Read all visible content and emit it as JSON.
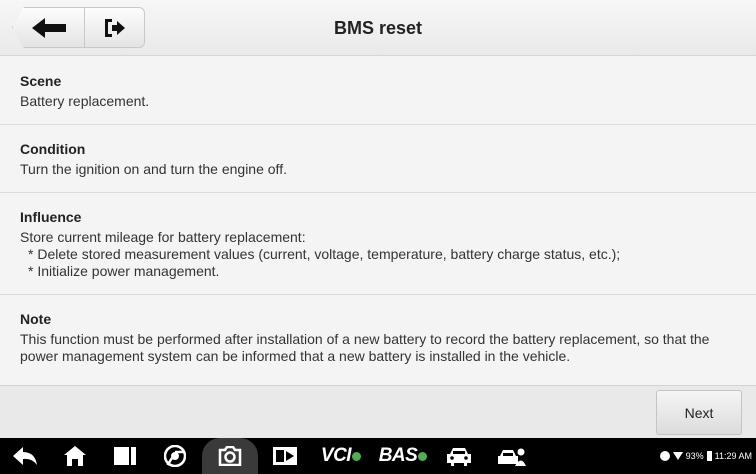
{
  "header": {
    "title": "BMS reset",
    "back_icon": "back-arrow-icon",
    "exit_icon": "exit-icon"
  },
  "sections": [
    {
      "title": "Scene",
      "body": "Battery replacement."
    },
    {
      "title": "Condition",
      "body": "Turn the ignition on and turn the engine off."
    },
    {
      "title": "Influence",
      "body": "Store current mileage for battery replacement:",
      "items": [
        "* Delete stored measurement values (current, voltage, temperature, battery charge status, etc.);",
        "* Initialize power management."
      ]
    },
    {
      "title": "Note",
      "body": "This function must be performed after installation of a new battery to record the battery replacement, so that the power management system can be informed that a new battery is installed in the vehicle."
    }
  ],
  "footer": {
    "next_label": "Next"
  },
  "sysbar": {
    "vci_label": "VCI",
    "bas_label": "BAS",
    "battery_percent": "93%",
    "time": "11:29 AM",
    "colors": {
      "bg": "#000000",
      "badge": "#4caf50"
    }
  }
}
